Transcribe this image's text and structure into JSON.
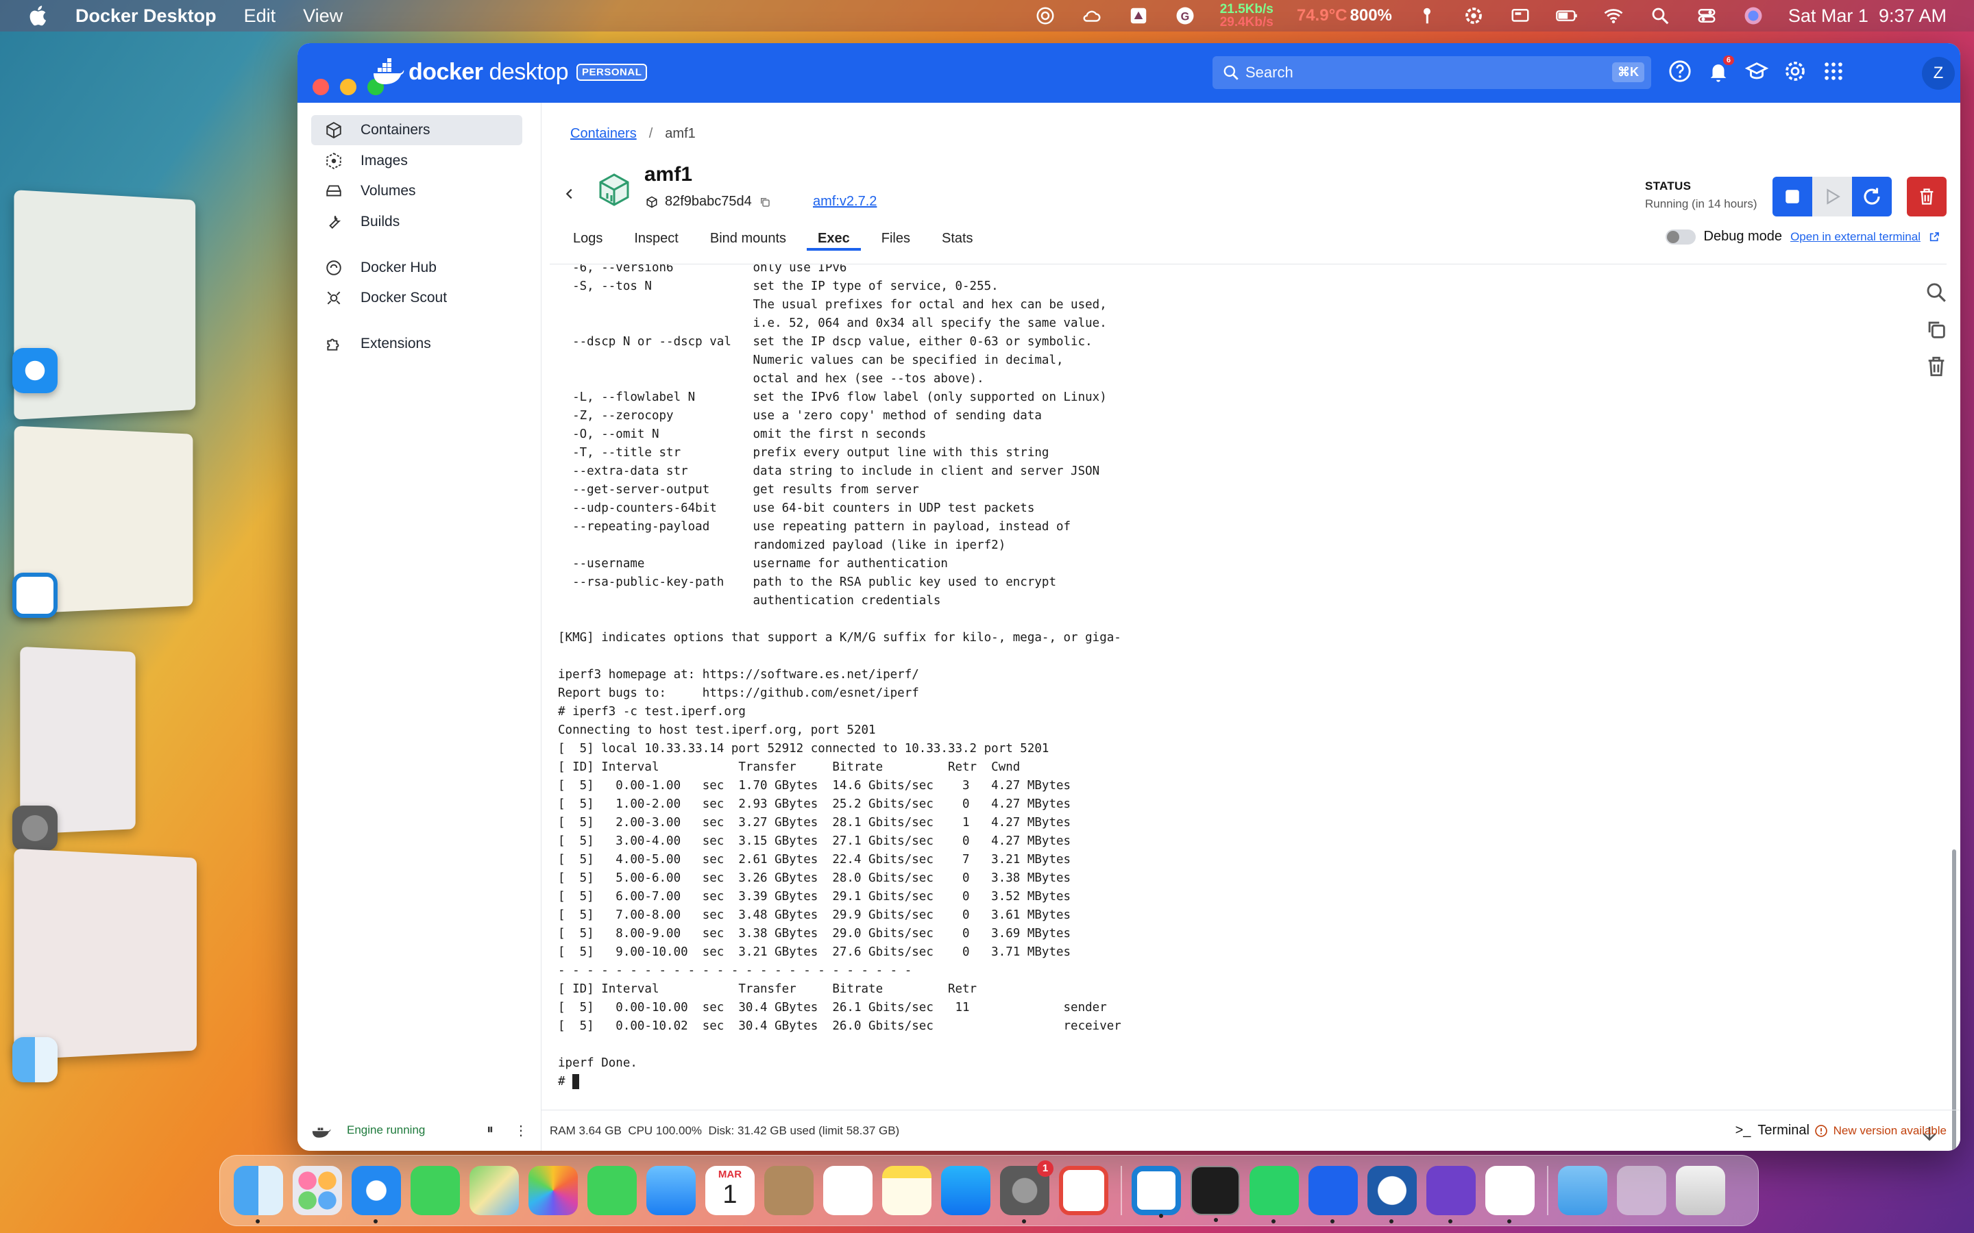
{
  "menubar": {
    "app_name": "Docker Desktop",
    "menu_items": [
      "Edit",
      "View"
    ],
    "net_up": "21.5Kb/s",
    "net_down": "29.4Kb/s",
    "temperature": "74.9°C",
    "cpu_percent": "800%",
    "date_time": "Sat Mar 1  9:37 AM"
  },
  "window": {
    "brand_light": "docker",
    "brand_bold": "desktop",
    "plan_badge": "PERSONAL",
    "search_placeholder": "Search",
    "search_shortcut": "⌘K",
    "notification_count": "6",
    "avatar_letter": "Z"
  },
  "sidebar": {
    "items": [
      {
        "label": "Containers",
        "icon": "container-icon"
      },
      {
        "label": "Images",
        "icon": "image-icon"
      },
      {
        "label": "Volumes",
        "icon": "volume-icon"
      },
      {
        "label": "Builds",
        "icon": "wrench-icon"
      },
      {
        "label": "Docker Hub",
        "icon": "hub-icon"
      },
      {
        "label": "Docker Scout",
        "icon": "scout-icon"
      },
      {
        "label": "Extensions",
        "icon": "puzzle-icon"
      }
    ],
    "engine_status": "Engine running"
  },
  "container": {
    "breadcrumb_root": "Containers",
    "breadcrumb_sep": "/",
    "breadcrumb_current": "amf1",
    "name": "amf1",
    "id": "82f9babc75d4",
    "image": "amf:v2.7.2",
    "status_label": "STATUS",
    "status_value": "Running (in 14 hours)"
  },
  "tabs": [
    "Logs",
    "Inspect",
    "Bind mounts",
    "Exec",
    "Files",
    "Stats"
  ],
  "active_tab": "Exec",
  "debug": {
    "label": "Debug mode",
    "external_link": "Open in external terminal"
  },
  "terminal": {
    "lines": [
      "  -6, --version6           only use IPv6",
      "  -S, --tos N              set the IP type of service, 0-255.",
      "                           The usual prefixes for octal and hex can be used,",
      "                           i.e. 52, 064 and 0x34 all specify the same value.",
      "  --dscp N or --dscp val   set the IP dscp value, either 0-63 or symbolic.",
      "                           Numeric values can be specified in decimal,",
      "                           octal and hex (see --tos above).",
      "  -L, --flowlabel N        set the IPv6 flow label (only supported on Linux)",
      "  -Z, --zerocopy           use a 'zero copy' method of sending data",
      "  -O, --omit N             omit the first n seconds",
      "  -T, --title str          prefix every output line with this string",
      "  --extra-data str         data string to include in client and server JSON",
      "  --get-server-output      get results from server",
      "  --udp-counters-64bit     use 64-bit counters in UDP test packets",
      "  --repeating-payload      use repeating pattern in payload, instead of",
      "                           randomized payload (like in iperf2)",
      "  --username               username for authentication",
      "  --rsa-public-key-path    path to the RSA public key used to encrypt",
      "                           authentication credentials",
      "",
      "[KMG] indicates options that support a K/M/G suffix for kilo-, mega-, or giga-",
      "",
      "iperf3 homepage at: https://software.es.net/iperf/",
      "Report bugs to:     https://github.com/esnet/iperf",
      "# iperf3 -c test.iperf.org",
      "Connecting to host test.iperf.org, port 5201",
      "[  5] local 10.33.33.14 port 52912 connected to 10.33.33.2 port 5201",
      "[ ID] Interval           Transfer     Bitrate         Retr  Cwnd",
      "[  5]   0.00-1.00   sec  1.70 GBytes  14.6 Gbits/sec    3   4.27 MBytes",
      "[  5]   1.00-2.00   sec  2.93 GBytes  25.2 Gbits/sec    0   4.27 MBytes",
      "[  5]   2.00-3.00   sec  3.27 GBytes  28.1 Gbits/sec    1   4.27 MBytes",
      "[  5]   3.00-4.00   sec  3.15 GBytes  27.1 Gbits/sec    0   4.27 MBytes",
      "[  5]   4.00-5.00   sec  2.61 GBytes  22.4 Gbits/sec    7   3.21 MBytes",
      "[  5]   5.00-6.00   sec  3.26 GBytes  28.0 Gbits/sec    0   3.38 MBytes",
      "[  5]   6.00-7.00   sec  3.39 GBytes  29.1 Gbits/sec    0   3.52 MBytes",
      "[  5]   7.00-8.00   sec  3.48 GBytes  29.9 Gbits/sec    0   3.61 MBytes",
      "[  5]   8.00-9.00   sec  3.38 GBytes  29.0 Gbits/sec    0   3.69 MBytes",
      "[  5]   9.00-10.00  sec  3.21 GBytes  27.6 Gbits/sec    0   3.71 MBytes",
      "- - - - - - - - - - - - - - - - - - - - - - - - -",
      "[ ID] Interval           Transfer     Bitrate         Retr",
      "[  5]   0.00-10.00  sec  30.4 GBytes  26.1 Gbits/sec   11             sender",
      "[  5]   0.00-10.02  sec  30.4 GBytes  26.0 Gbits/sec                  receiver",
      "",
      "iperf Done.",
      "# "
    ]
  },
  "footer": {
    "stats": "RAM 3.64 GB  CPU 100.00%  Disk: 31.42 GB used (limit 58.37 GB)",
    "terminal_label": "Terminal",
    "new_version": "New version available"
  },
  "dock": {
    "calendar_month": "MAR",
    "calendar_day": "1",
    "settings_badge": "1"
  },
  "colors": {
    "docker_blue": "#1d63ed",
    "delete_red": "#d32f2f",
    "engine_green": "#1e7a3c",
    "warning_orange": "#c2410c"
  }
}
